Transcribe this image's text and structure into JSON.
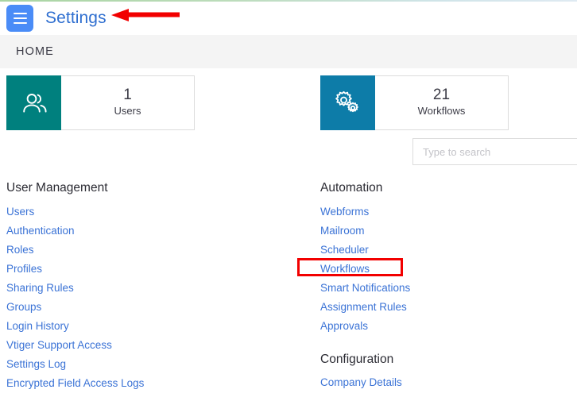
{
  "header": {
    "menu_icon": "hamburger-menu-icon",
    "title": "Settings"
  },
  "breadcrumb": {
    "items": [
      "HOME"
    ]
  },
  "cards": [
    {
      "icon": "users-icon",
      "count": "1",
      "label": "Users",
      "icon_color": "#00807e"
    },
    {
      "icon": "gears-icon",
      "count": "21",
      "label": "Workflows",
      "icon_color": "#0d7ca8"
    }
  ],
  "search": {
    "placeholder": "Type to search",
    "value": ""
  },
  "columns": {
    "left": [
      {
        "title": "User Management",
        "links": [
          "Users",
          "Authentication",
          "Roles",
          "Profiles",
          "Sharing Rules",
          "Groups",
          "Login History",
          "Vtiger Support Access",
          "Settings Log",
          "Encrypted Field Access Logs"
        ]
      }
    ],
    "right": [
      {
        "title": "Automation",
        "links": [
          "Webforms",
          "Mailroom",
          "Scheduler",
          "Workflows",
          "Smart Notifications",
          "Assignment Rules",
          "Approvals"
        ]
      },
      {
        "title": "Configuration",
        "links": [
          "Company Details"
        ]
      }
    ]
  },
  "annotations": {
    "arrow": {
      "name": "red-left-arrow",
      "color": "#f20000",
      "points_to": "Settings"
    },
    "highlight": {
      "name": "red-highlight-box",
      "color": "#f20000",
      "target": "Workflows"
    }
  },
  "colors": {
    "link": "#3b73d6",
    "title": "#2f6fd0",
    "menu_button": "#4a8cf7",
    "annotation": "#f20000"
  }
}
